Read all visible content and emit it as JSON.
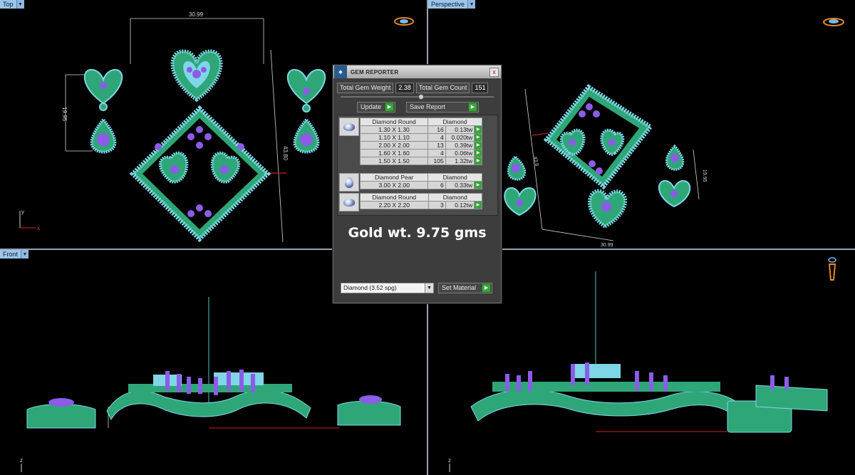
{
  "viewports": {
    "top": {
      "label": "Top",
      "dim_width": "30.99",
      "dim_height": "43.80",
      "dim_earring": "19.95",
      "axis_y": "y",
      "axis_x": "x"
    },
    "perspective": {
      "label": "Perspective",
      "dim_a": "43.8",
      "dim_b": "19.95",
      "dim_c": "30.99"
    },
    "front": {
      "label": "Front",
      "axis_z": "z"
    },
    "right": {
      "axis_z": "z"
    }
  },
  "gem_reporter": {
    "title": "GEM REPORTER",
    "close": "x",
    "total_gem_weight_label": "Total Gem Weight",
    "total_gem_weight": "2.38",
    "total_gem_count_label": "Total Gem Count",
    "total_gem_count": "151",
    "update_label": "Update",
    "save_report_label": "Save Report",
    "groups": [
      {
        "shape": "Diamond Round",
        "material": "Diamond",
        "rows": [
          {
            "size": "1.30 X 1.30",
            "count": "16",
            "weight": "0.13tw"
          },
          {
            "size": "1.10 X 1.10",
            "count": "4",
            "weight": "0.020tw"
          },
          {
            "size": "2.00 X 2.00",
            "count": "13",
            "weight": "0.39tw"
          },
          {
            "size": "1.60 X 1.60",
            "count": "4",
            "weight": "0.06tw"
          },
          {
            "size": "1.50 X 1.50",
            "count": "105",
            "weight": "1.32tw"
          }
        ]
      },
      {
        "shape": "Diamond Pear",
        "material": "Diamond",
        "rows": [
          {
            "size": "3.00 X 2.00",
            "count": "6",
            "weight": "0.33tw"
          }
        ]
      },
      {
        "shape": "Diamond Round",
        "material": "Diamond",
        "rows": [
          {
            "size": "2.20 X 2.20",
            "count": "3",
            "weight": "0.12tw"
          }
        ]
      }
    ],
    "gold_weight_text": "Gold wt. 9.75 gms",
    "material_select": "Diamond    (3.52 spg)",
    "set_material_label": "Set Material"
  },
  "colors": {
    "metal": "#2fa678",
    "gem": "#7fd6e6",
    "accent_gem": "#8c5ce8",
    "dimension": "#cfd8cf"
  }
}
